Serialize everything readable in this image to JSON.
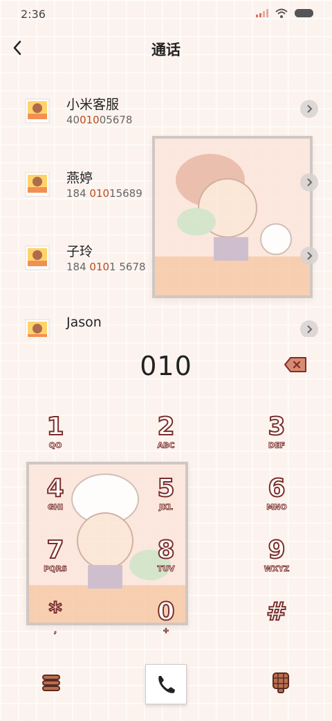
{
  "status_bar": {
    "time": "2:36",
    "icons": [
      "signal-icon",
      "wifi-icon",
      "battery-icon"
    ]
  },
  "header": {
    "title": "通话",
    "back_icon": "chevron-left-icon"
  },
  "contacts": [
    {
      "name": "小米客服",
      "number_parts": [
        "40",
        "010",
        "05678"
      ],
      "avatar": "sticker-avatar-icon"
    },
    {
      "name": "燕婷",
      "number_parts": [
        "184 ",
        "010",
        "15689"
      ],
      "avatar": "sticker-avatar-icon"
    },
    {
      "name": "子玲",
      "number_parts": [
        "184 ",
        "010",
        "1 5678"
      ],
      "avatar": "sticker-avatar-icon"
    },
    {
      "name": "Jason",
      "number_parts": [
        "",
        "",
        ""
      ],
      "avatar": "sticker-avatar-icon"
    }
  ],
  "dial": {
    "value": "010",
    "delete_icon": "backspace-icon"
  },
  "keypad": [
    {
      "digit": "1",
      "letters": "QO"
    },
    {
      "digit": "2",
      "letters": "ABC"
    },
    {
      "digit": "3",
      "letters": "DEF"
    },
    {
      "digit": "4",
      "letters": "GHI"
    },
    {
      "digit": "5",
      "letters": "JKL"
    },
    {
      "digit": "6",
      "letters": "MNO"
    },
    {
      "digit": "7",
      "letters": "PQRS"
    },
    {
      "digit": "8",
      "letters": "TUV"
    },
    {
      "digit": "9",
      "letters": "WXYZ"
    },
    {
      "digit": "*",
      "letters": ","
    },
    {
      "digit": "0",
      "letters": "+"
    },
    {
      "digit": "#",
      "letters": ""
    }
  ],
  "bottom_bar": {
    "menu_icon": "menu-icon",
    "call_icon": "phone-icon",
    "keypad_icon": "dialpad-icon"
  },
  "colors": {
    "background": "#fdf3ee",
    "accent": "#b84a1c",
    "key_outline": "#7a2e2a"
  }
}
